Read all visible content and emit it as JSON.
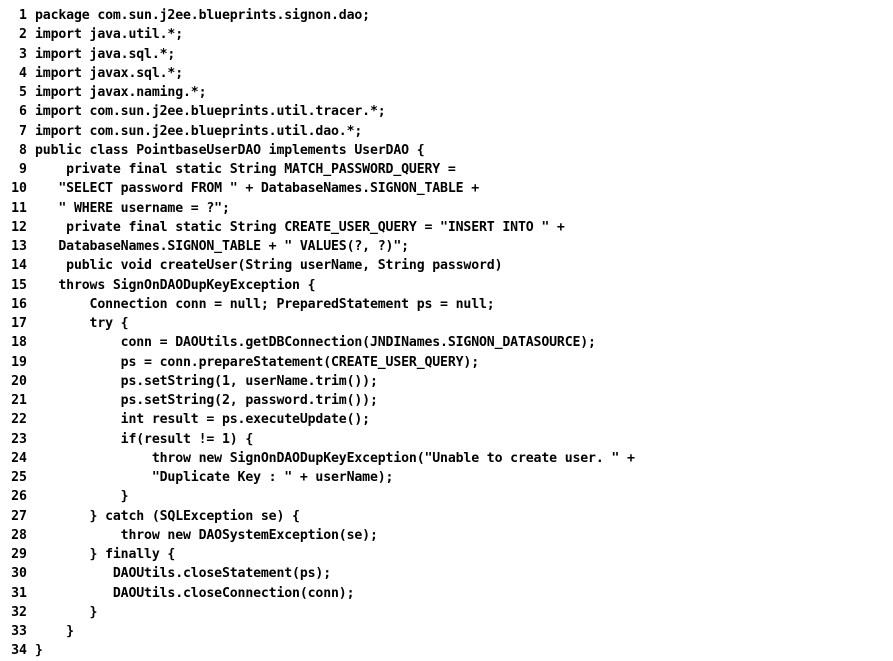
{
  "listing": {
    "language": "java",
    "background_color": "#ffffff",
    "text_color": "#000000",
    "total_lines": 34,
    "lines": [
      {
        "num": "1",
        "text": "package com.sun.j2ee.blueprints.signon.dao;"
      },
      {
        "num": "2",
        "text": "import java.util.*;"
      },
      {
        "num": "3",
        "text": "import java.sql.*;"
      },
      {
        "num": "4",
        "text": "import javax.sql.*;"
      },
      {
        "num": "5",
        "text": "import javax.naming.*;"
      },
      {
        "num": "6",
        "text": "import com.sun.j2ee.blueprints.util.tracer.*;"
      },
      {
        "num": "7",
        "text": "import com.sun.j2ee.blueprints.util.dao.*;"
      },
      {
        "num": "8",
        "text": "public class PointbaseUserDAO implements UserDAO {"
      },
      {
        "num": "9",
        "text": "    private final static String MATCH_PASSWORD_QUERY ="
      },
      {
        "num": "10",
        "text": "   \"SELECT password FROM \" + DatabaseNames.SIGNON_TABLE +"
      },
      {
        "num": "11",
        "text": "   \" WHERE username = ?\";"
      },
      {
        "num": "12",
        "text": "    private final static String CREATE_USER_QUERY = \"INSERT INTO \" +"
      },
      {
        "num": "13",
        "text": "   DatabaseNames.SIGNON_TABLE + \" VALUES(?, ?)\";"
      },
      {
        "num": "14",
        "text": "    public void createUser(String userName, String password)"
      },
      {
        "num": "15",
        "text": "   throws SignOnDAODupKeyException {"
      },
      {
        "num": "16",
        "text": "       Connection conn = null; PreparedStatement ps = null;"
      },
      {
        "num": "17",
        "text": "       try {"
      },
      {
        "num": "18",
        "text": "           conn = DAOUtils.getDBConnection(JNDINames.SIGNON_DATASOURCE);"
      },
      {
        "num": "19",
        "text": "           ps = conn.prepareStatement(CREATE_USER_QUERY);"
      },
      {
        "num": "20",
        "text": "           ps.setString(1, userName.trim());"
      },
      {
        "num": "21",
        "text": "           ps.setString(2, password.trim());"
      },
      {
        "num": "22",
        "text": "           int result = ps.executeUpdate();"
      },
      {
        "num": "23",
        "text": "           if(result != 1) {"
      },
      {
        "num": "24",
        "text": "               throw new SignOnDAODupKeyException(\"Unable to create user. \" +"
      },
      {
        "num": "25",
        "text": "               \"Duplicate Key : \" + userName);"
      },
      {
        "num": "26",
        "text": "           }"
      },
      {
        "num": "27",
        "text": "       } catch (SQLException se) {"
      },
      {
        "num": "28",
        "text": "           throw new DAOSystemException(se);"
      },
      {
        "num": "29",
        "text": "       } finally {"
      },
      {
        "num": "30",
        "text": "          DAOUtils.closeStatement(ps);"
      },
      {
        "num": "31",
        "text": "          DAOUtils.closeConnection(conn);"
      },
      {
        "num": "32",
        "text": "       }"
      },
      {
        "num": "33",
        "text": "    }"
      },
      {
        "num": "34",
        "text": "}"
      }
    ]
  }
}
